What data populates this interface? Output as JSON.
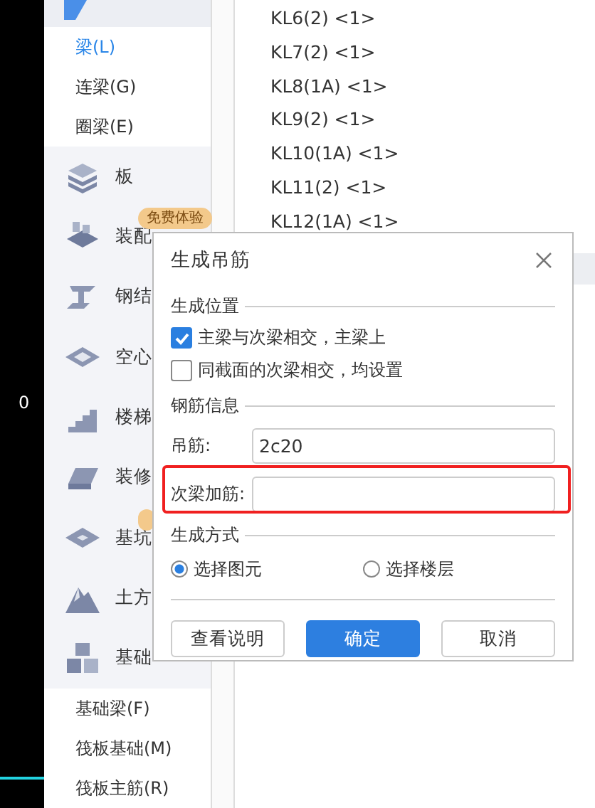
{
  "side_strip": {
    "label": "0"
  },
  "sidebar": {
    "items": [
      {
        "kind": "sub",
        "label": "梁(L)",
        "selected": true
      },
      {
        "kind": "sub",
        "label": "连梁(G)",
        "selected": false
      },
      {
        "kind": "sub",
        "label": "圈梁(E)",
        "selected": false
      },
      {
        "kind": "group",
        "label": "板"
      },
      {
        "kind": "group",
        "label": "装配",
        "badged": true,
        "badge": "免费体验"
      },
      {
        "kind": "group",
        "label": "钢结"
      },
      {
        "kind": "group",
        "label": "空心"
      },
      {
        "kind": "group",
        "label": "楼梯"
      },
      {
        "kind": "group",
        "label": "装修"
      },
      {
        "kind": "group",
        "label": "基坑",
        "badged": true
      },
      {
        "kind": "group",
        "label": "土方"
      },
      {
        "kind": "group",
        "label": "基础"
      },
      {
        "kind": "sub",
        "label": "基础梁(F)",
        "selected": false
      },
      {
        "kind": "sub",
        "label": "筏板基础(M)",
        "selected": false
      },
      {
        "kind": "sub",
        "label": "筏板主筋(R)",
        "selected": false
      }
    ]
  },
  "list": {
    "items": [
      "KL6(2) <1>",
      "KL7(2) <1>",
      "KL8(1A) <1>",
      "KL9(2) <1>",
      "KL10(1A) <1>",
      "KL11(2) <1>",
      "KL12(1A) <1>"
    ]
  },
  "dialog": {
    "title": "生成吊筋",
    "location": {
      "heading": "生成位置",
      "options": [
        {
          "label": "主梁与次梁相交，主梁上",
          "checked": true
        },
        {
          "label": "同截面的次梁相交，均设置",
          "checked": false
        }
      ]
    },
    "rebar": {
      "heading": "钢筋信息",
      "fields": [
        {
          "label": "吊筋:",
          "value": "2c20"
        },
        {
          "label": "次梁加筋:"
        }
      ]
    },
    "method": {
      "heading": "生成方式",
      "options": [
        {
          "label": "选择图元",
          "selected": true
        },
        {
          "label": "选择楼层",
          "selected": false
        }
      ]
    },
    "buttons": [
      {
        "label": "查看说明",
        "kind": "normal"
      },
      {
        "label": "确定",
        "kind": "primary"
      },
      {
        "label": "取消",
        "kind": "normal"
      }
    ]
  }
}
